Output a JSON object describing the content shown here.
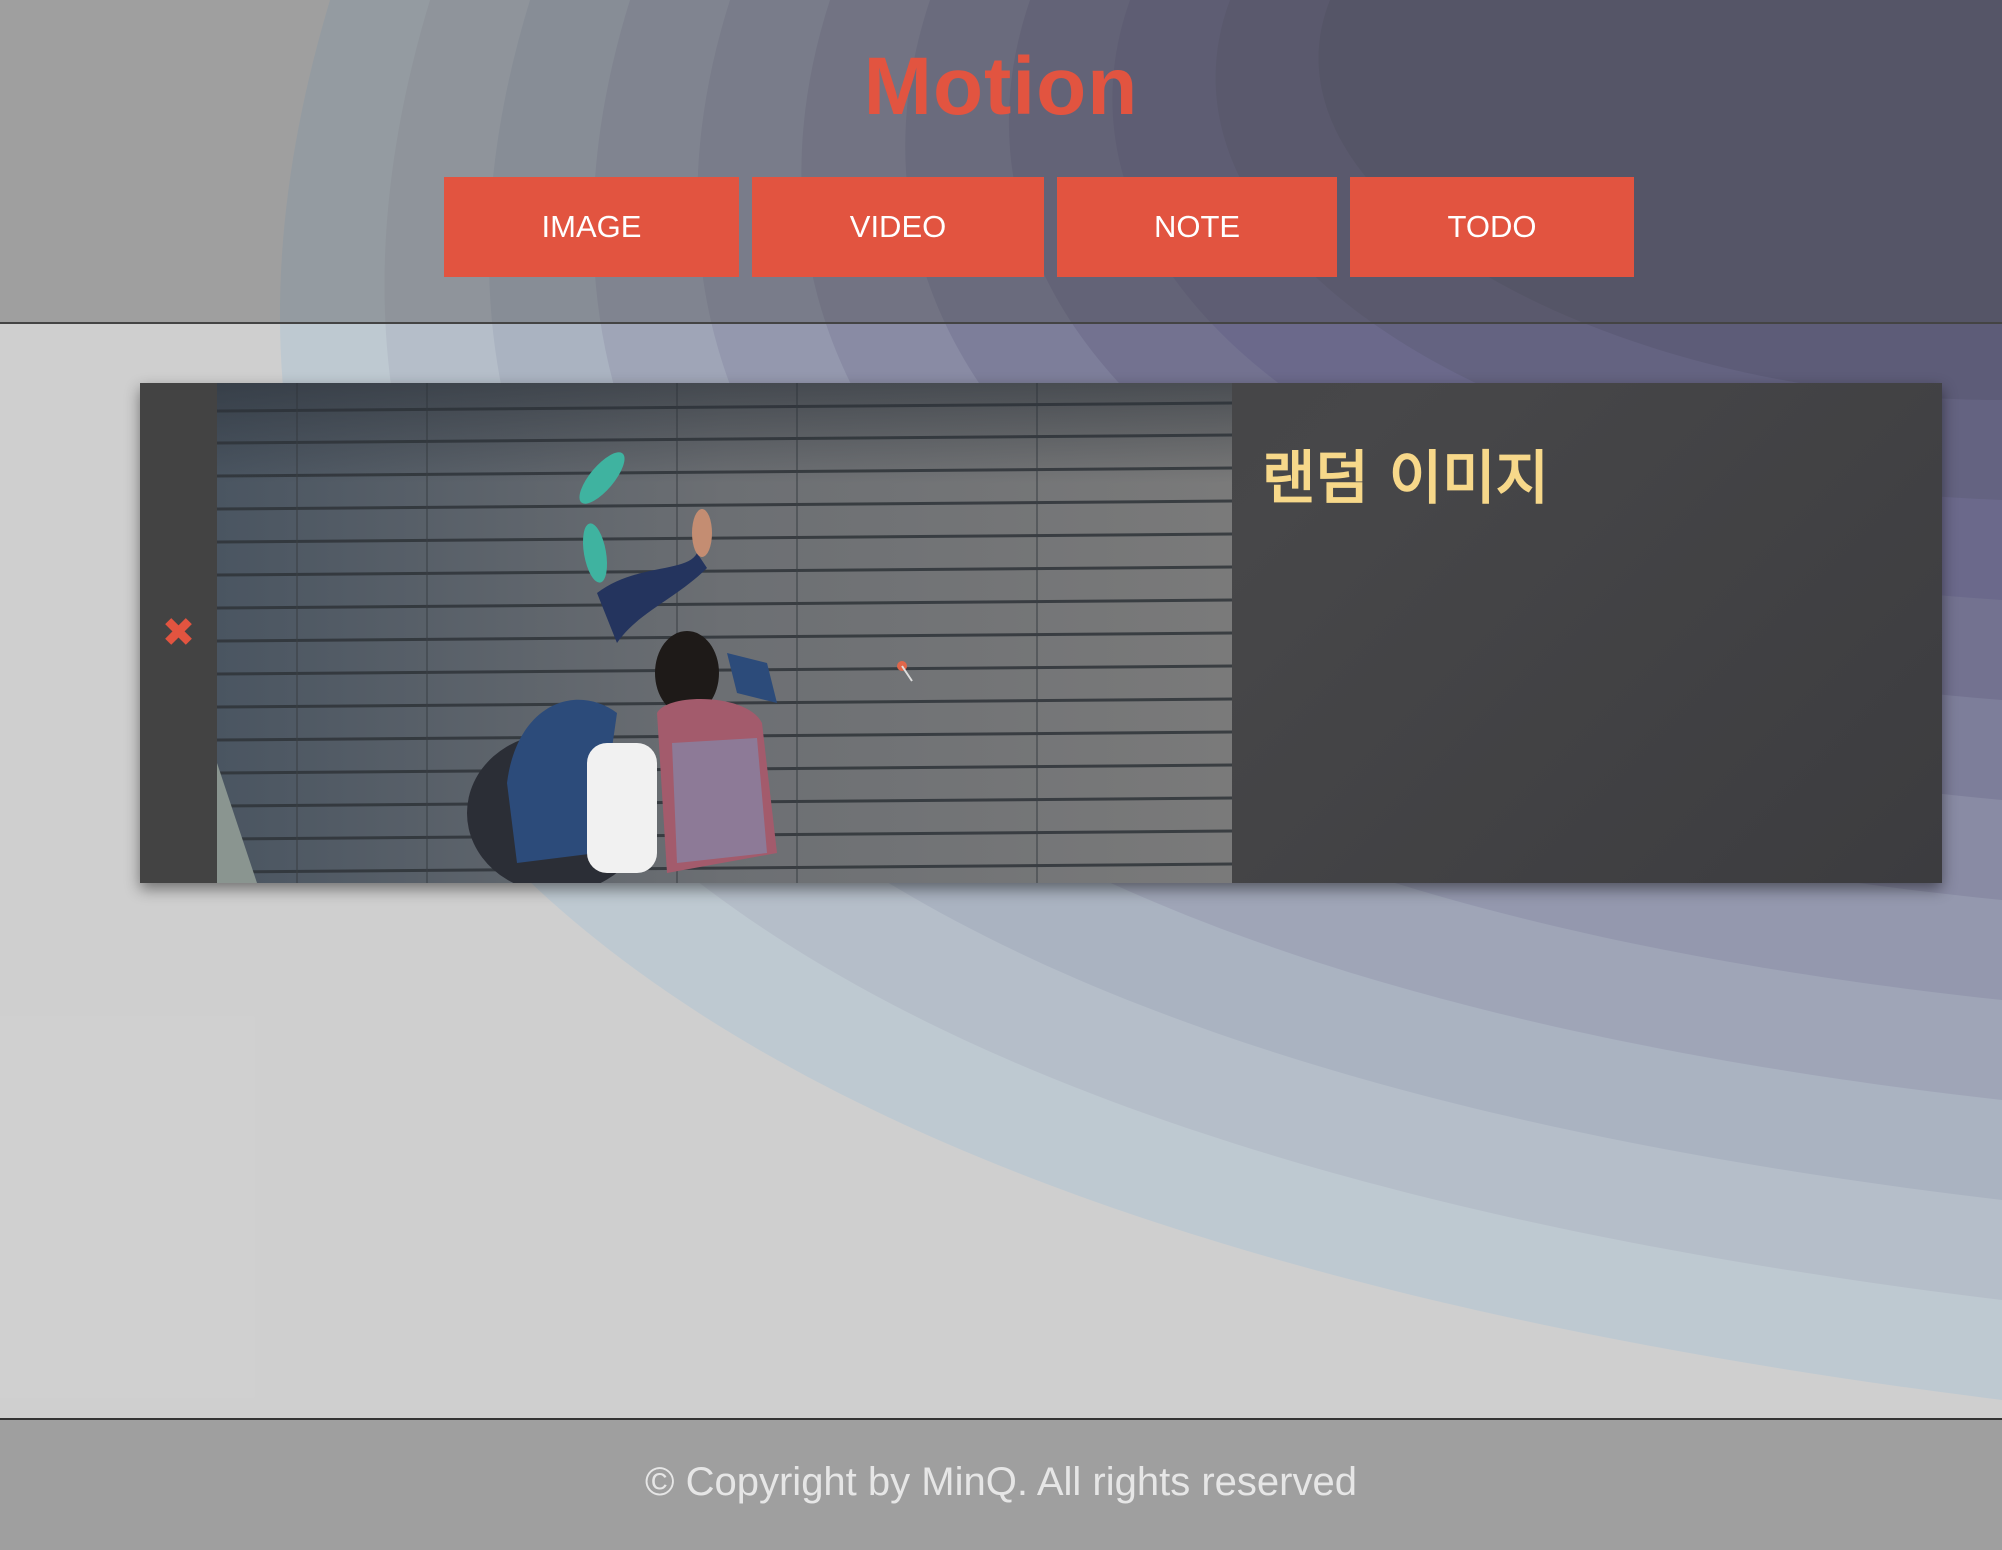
{
  "header": {
    "title": "Motion",
    "nav": [
      {
        "label": "IMAGE"
      },
      {
        "label": "VIDEO"
      },
      {
        "label": "NOTE"
      },
      {
        "label": "TODO"
      }
    ]
  },
  "card": {
    "close_icon": "close-icon",
    "close_glyph": "✖",
    "title": "랜덤 이미지"
  },
  "footer": {
    "copyright": "© Copyright by MinQ. All rights reserved"
  },
  "colors": {
    "accent": "#e25440",
    "card_title": "#f7d88a",
    "header_dark": "#1a1a3c"
  }
}
